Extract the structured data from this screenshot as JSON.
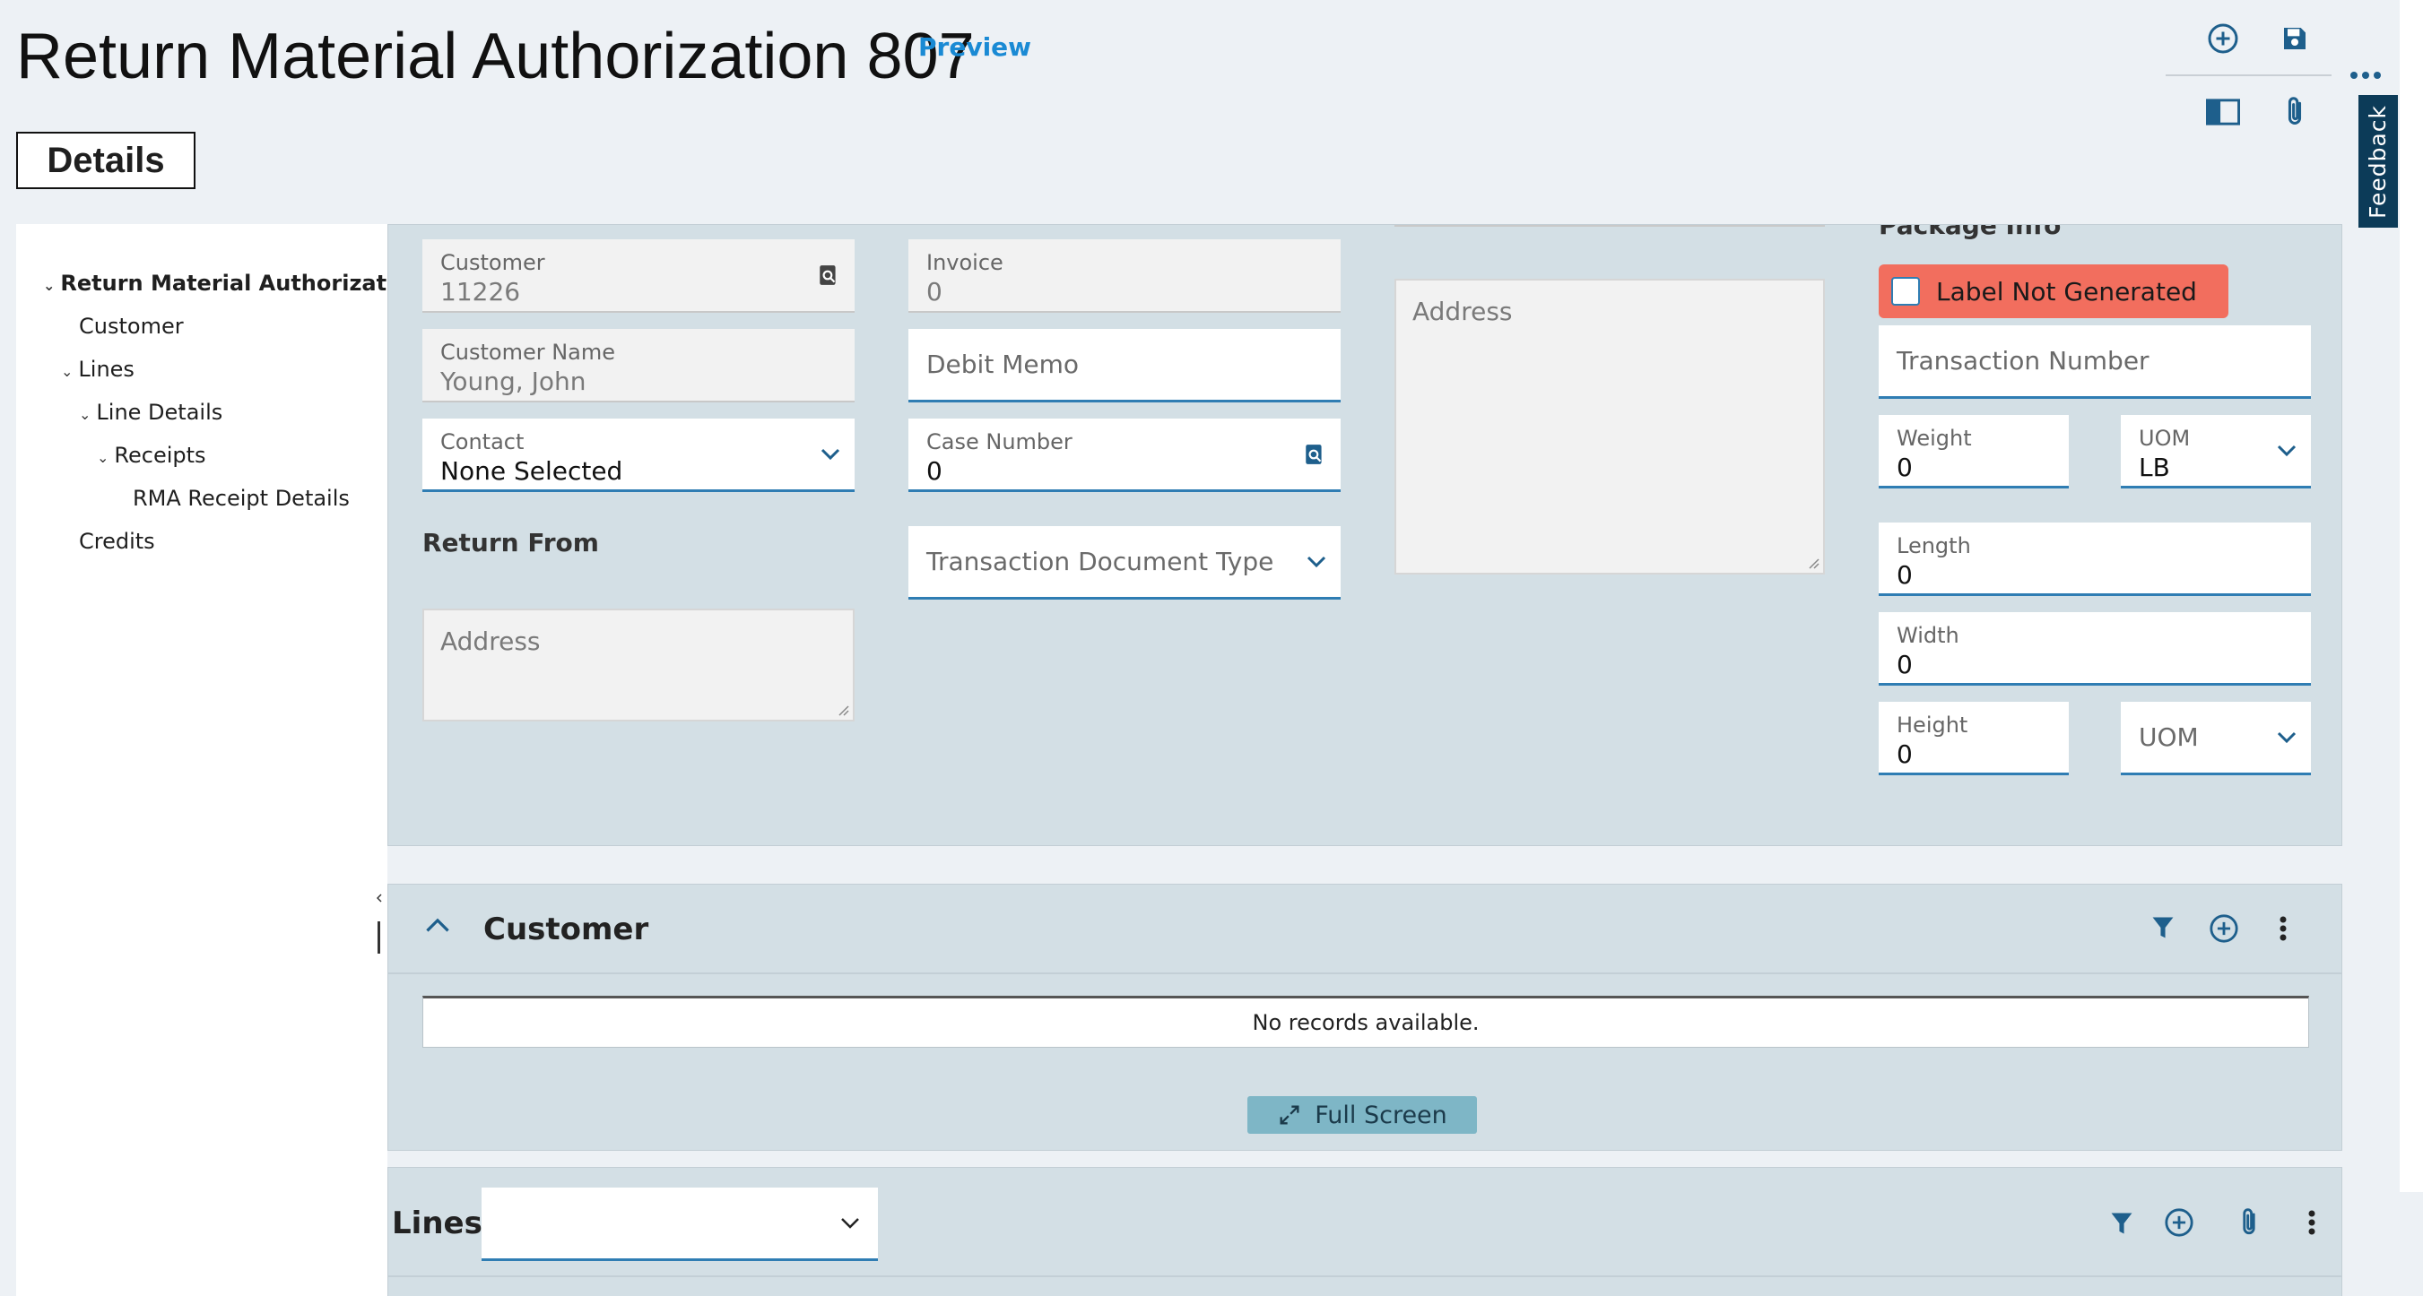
{
  "header": {
    "title": "Return Material Authorization 807",
    "preview_label": "Preview",
    "details_label": "Details",
    "feedback_label": "Feedback"
  },
  "tree": {
    "items": [
      {
        "label": "Return Material Authorization {",
        "expanded": true,
        "bold": true
      },
      {
        "label": "Customer"
      },
      {
        "label": "Lines",
        "expanded": true
      },
      {
        "label": "Line Details",
        "expanded": true
      },
      {
        "label": "Receipts",
        "expanded": true
      },
      {
        "label": "RMA Receipt Details"
      },
      {
        "label": "Credits"
      }
    ]
  },
  "form": {
    "customer": {
      "label": "Customer",
      "value": "11226"
    },
    "customer_name": {
      "label": "Customer Name",
      "value": "Young, John"
    },
    "contact": {
      "label": "Contact",
      "value": "None Selected"
    },
    "return_from": "Return From",
    "return_from_address_placeholder": "Address",
    "invoice": {
      "label": "Invoice",
      "value": "0"
    },
    "debit_memo_placeholder": "Debit Memo",
    "case_number": {
      "label": "Case Number",
      "value": "0"
    },
    "transaction_document_type_placeholder": "Transaction Document Type",
    "address_placeholder": "Address",
    "package_info_heading": "Package Info",
    "label_status": "Label Not Generated",
    "transaction_number_placeholder": "Transaction Number",
    "weight": {
      "label": "Weight",
      "value": "0"
    },
    "weight_uom": {
      "label": "UOM",
      "value": "LB"
    },
    "length": {
      "label": "Length",
      "value": "0"
    },
    "width": {
      "label": "Width",
      "value": "0"
    },
    "height": {
      "label": "Height",
      "value": "0"
    },
    "dimension_uom_placeholder": "UOM"
  },
  "customer_section": {
    "title": "Customer",
    "empty_message": "No records available.",
    "full_screen_label": "Full Screen"
  },
  "lines_section": {
    "title": "Lines",
    "select_value": ""
  },
  "colors": {
    "accent": "#2f7db3",
    "panel_bg": "#d3dfe5",
    "label_warning": "#f26e5e",
    "feedback_bg": "#0c3b58"
  }
}
